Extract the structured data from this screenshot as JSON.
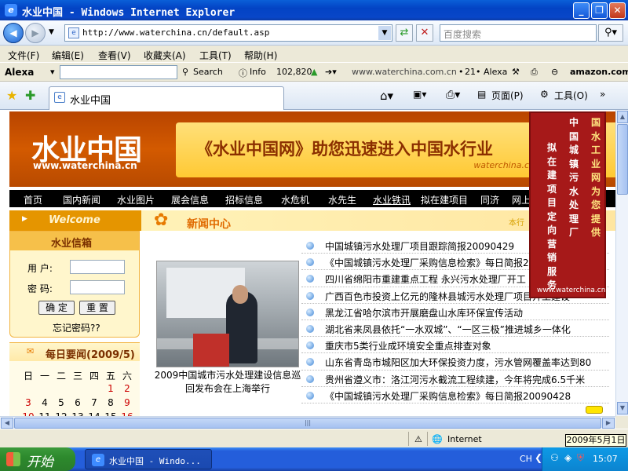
{
  "window": {
    "title": "水业中国 - Windows Internet Explorer",
    "min_label": "_",
    "max_label": "❐",
    "close_label": "✕"
  },
  "address": {
    "url": "http://www.waterchina.cn/default.asp",
    "search_placeholder": "百度搜索"
  },
  "menu": [
    "文件(F)",
    "编辑(E)",
    "查看(V)",
    "收藏夹(A)",
    "工具(T)",
    "帮助(H)"
  ],
  "alexa": {
    "brand": "Alexa",
    "search_label": "Search",
    "info_label": "Info",
    "rank": "102,820",
    "site": "www.waterchina.com.cn",
    "count": "21",
    "alexa_label": "Alexa",
    "amazon": "amazon.com"
  },
  "tab": {
    "label": "水业中国",
    "page_label": "页面(P)",
    "tools_label": "工具(O)"
  },
  "site": {
    "logo": "水业中国",
    "logo_url": "www.waterchina.cn",
    "slogan": "《水业中国网》助您迅速进入中国水行业",
    "slogan_url": "waterchina.c",
    "nav": [
      "首页",
      "国内新闻",
      "水业图片",
      "展会信息",
      "招标信息",
      "水危机",
      "水先生",
      "水业铁讯",
      "拟在建项目",
      "同济",
      "网上"
    ],
    "welcome": "Welcome",
    "news_center": "新闻中心",
    "bookmark": "本行",
    "mailbox": {
      "title": "水业信箱",
      "user_label": "用  户:",
      "pass_label": "密  码:",
      "ok": "确 定",
      "reset": "重 置",
      "forgot": "忘记密码??"
    },
    "daily_title": "每日要闻(2009/5)",
    "calendar": {
      "headers": [
        "日",
        "一",
        "二",
        "三",
        "四",
        "五",
        "六"
      ],
      "row1": [
        "",
        "",
        "",
        "",
        "",
        "1",
        "2"
      ],
      "row2": [
        "3",
        "4",
        "5",
        "6",
        "7",
        "8",
        "9"
      ],
      "row3": [
        "10",
        "11",
        "12",
        "13",
        "14",
        "15",
        "16"
      ]
    },
    "photo_caption": "2009中国城市污水处理建设信息巡回发布会在上海举行",
    "news": [
      "中国城镇污水处理厂项目跟踪简报20090429",
      "《中国城镇污水处理厂采购信息检索》每日简报20",
      "四川省绵阳市重建重点工程 永兴污水处理厂开工",
      "广西百色市投资上亿元的隆林县城污水处理厂项目开工建设",
      "黑龙江省哈尔滨市开展磨盘山水库环保宣传活动",
      "湖北省来凤县依托“一水双城”、“一区三极”推进城乡一体化",
      "重庆市5类行业成环境安全重点排查对象",
      "山东省青岛市城阳区加大环保投资力度，污水管网覆盖率达到80",
      "贵州省遵义市：洛江河污水截流工程续建，今年将完成6.5千米",
      "《中国城镇污水处理厂采购信息检索》每日简报20090428"
    ],
    "ad": {
      "cols": [
        "国水工业网为您提供",
        "中国城镇污水处理厂",
        "拟在建项目定向营销服务"
      ],
      "url": "www.waterchina.cn"
    }
  },
  "status": {
    "zone": "Internet",
    "date_tip": "2009年5月1日"
  },
  "taskbar": {
    "start": "开始",
    "task": "水业中国 - Windo...",
    "lang": "CH",
    "clock": "15:07"
  }
}
